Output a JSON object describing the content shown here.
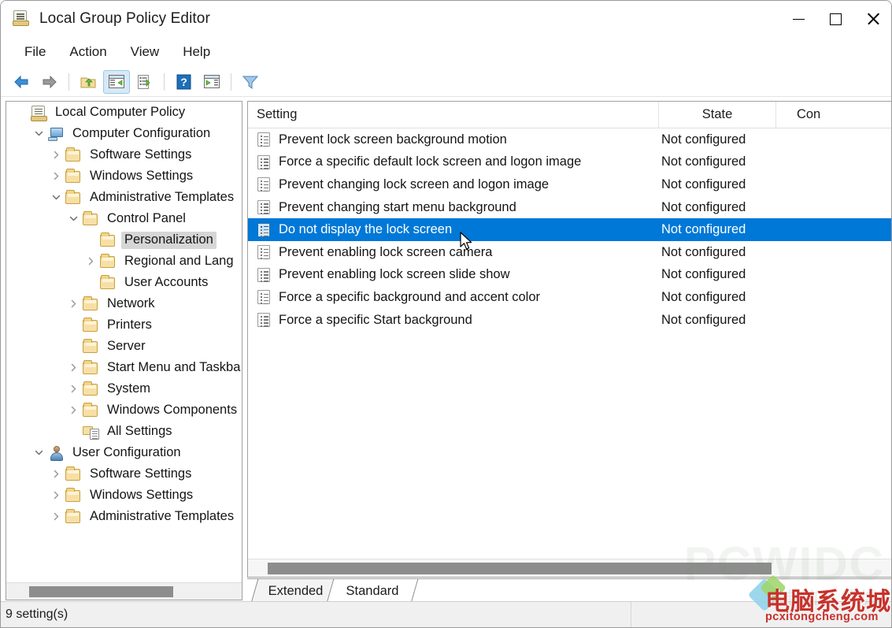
{
  "window": {
    "title": "Local Group Policy Editor",
    "icon": "policy-scroll-icon",
    "controls": {
      "minimize": "—",
      "maximize": "☐",
      "close": "✕"
    }
  },
  "menubar": {
    "items": [
      "File",
      "Action",
      "View",
      "Help"
    ]
  },
  "toolbar": {
    "buttons": [
      {
        "name": "back-icon",
        "label": "Back"
      },
      {
        "name": "forward-icon",
        "label": "Forward"
      },
      {
        "name": "up-one-level-icon",
        "label": "Up One Level"
      },
      {
        "name": "show-hide-console-tree-icon",
        "label": "Show/Hide Console Tree"
      },
      {
        "name": "export-list-icon",
        "label": "Export List"
      },
      {
        "name": "help-icon",
        "label": "Help"
      },
      {
        "name": "show-hide-action-pane-icon",
        "label": "Show/Hide Action Pane"
      },
      {
        "name": "filter-icon",
        "label": "Filter"
      }
    ]
  },
  "tree": {
    "nodes": [
      {
        "label": "Local Computer Policy",
        "indent": 0,
        "chevron": "",
        "icon": "policy-scroll-icon",
        "selected": false
      },
      {
        "label": "Computer Configuration",
        "indent": 1,
        "chevron": "expanded",
        "icon": "computer-icon",
        "selected": false
      },
      {
        "label": "Software Settings",
        "indent": 2,
        "chevron": "collapsed",
        "icon": "folder-icon",
        "selected": false
      },
      {
        "label": "Windows Settings",
        "indent": 2,
        "chevron": "collapsed",
        "icon": "folder-icon",
        "selected": false
      },
      {
        "label": "Administrative Templates",
        "indent": 2,
        "chevron": "expanded",
        "icon": "folder-icon",
        "selected": false
      },
      {
        "label": "Control Panel",
        "indent": 3,
        "chevron": "expanded",
        "icon": "folder-icon",
        "selected": false
      },
      {
        "label": "Personalization",
        "indent": 4,
        "chevron": "",
        "icon": "folder-icon",
        "selected": true
      },
      {
        "label": "Regional and Lang",
        "indent": 4,
        "chevron": "collapsed",
        "icon": "folder-icon",
        "selected": false
      },
      {
        "label": "User Accounts",
        "indent": 4,
        "chevron": "",
        "icon": "folder-icon",
        "selected": false
      },
      {
        "label": "Network",
        "indent": 3,
        "chevron": "collapsed",
        "icon": "folder-icon",
        "selected": false
      },
      {
        "label": "Printers",
        "indent": 3,
        "chevron": "",
        "icon": "folder-icon",
        "selected": false
      },
      {
        "label": "Server",
        "indent": 3,
        "chevron": "",
        "icon": "folder-icon",
        "selected": false
      },
      {
        "label": "Start Menu and Taskba",
        "indent": 3,
        "chevron": "collapsed",
        "icon": "folder-icon",
        "selected": false
      },
      {
        "label": "System",
        "indent": 3,
        "chevron": "collapsed",
        "icon": "folder-icon",
        "selected": false
      },
      {
        "label": "Windows Components",
        "indent": 3,
        "chevron": "collapsed",
        "icon": "folder-icon",
        "selected": false
      },
      {
        "label": "All Settings",
        "indent": 3,
        "chevron": "",
        "icon": "all-settings-icon",
        "selected": false
      },
      {
        "label": "User Configuration",
        "indent": 1,
        "chevron": "expanded",
        "icon": "user-icon",
        "selected": false
      },
      {
        "label": "Software Settings",
        "indent": 2,
        "chevron": "collapsed",
        "icon": "folder-icon",
        "selected": false
      },
      {
        "label": "Windows Settings",
        "indent": 2,
        "chevron": "collapsed",
        "icon": "folder-icon",
        "selected": false
      },
      {
        "label": "Administrative Templates",
        "indent": 2,
        "chevron": "collapsed",
        "icon": "folder-icon",
        "selected": false
      }
    ]
  },
  "list": {
    "columns": [
      "Setting",
      "State",
      "Con"
    ],
    "rows": [
      {
        "setting": "Prevent lock screen background motion",
        "state": "Not configured",
        "selected": false
      },
      {
        "setting": "Force a specific default lock screen and logon image",
        "state": "Not configured",
        "selected": false
      },
      {
        "setting": "Prevent changing lock screen and logon image",
        "state": "Not configured",
        "selected": false
      },
      {
        "setting": "Prevent changing start menu background",
        "state": "Not configured",
        "selected": false
      },
      {
        "setting": "Do not display the lock screen",
        "state": "Not configured",
        "selected": true
      },
      {
        "setting": "Prevent enabling lock screen camera",
        "state": "Not configured",
        "selected": false
      },
      {
        "setting": "Prevent enabling lock screen slide show",
        "state": "Not configured",
        "selected": false
      },
      {
        "setting": "Force a specific background and accent color",
        "state": "Not configured",
        "selected": false
      },
      {
        "setting": "Force a specific Start background",
        "state": "Not configured",
        "selected": false
      }
    ]
  },
  "tabs": [
    {
      "label": "Extended",
      "active": false
    },
    {
      "label": "Standard",
      "active": true
    }
  ],
  "statusbar": {
    "text": "9 setting(s)"
  },
  "watermark": {
    "faint_top": "PCWIDC",
    "faint_sub": "电脑系统城",
    "brand_cn": "电脑系统城",
    "brand_url": "pcxitongcheng.com"
  },
  "colors": {
    "selection_blue": "#0078d7",
    "tree_selection_gray": "#d6d6d6",
    "window_bg": "#ffffff",
    "statusbar_bg": "#f0f0f0",
    "brand_red": "#c8312b"
  }
}
